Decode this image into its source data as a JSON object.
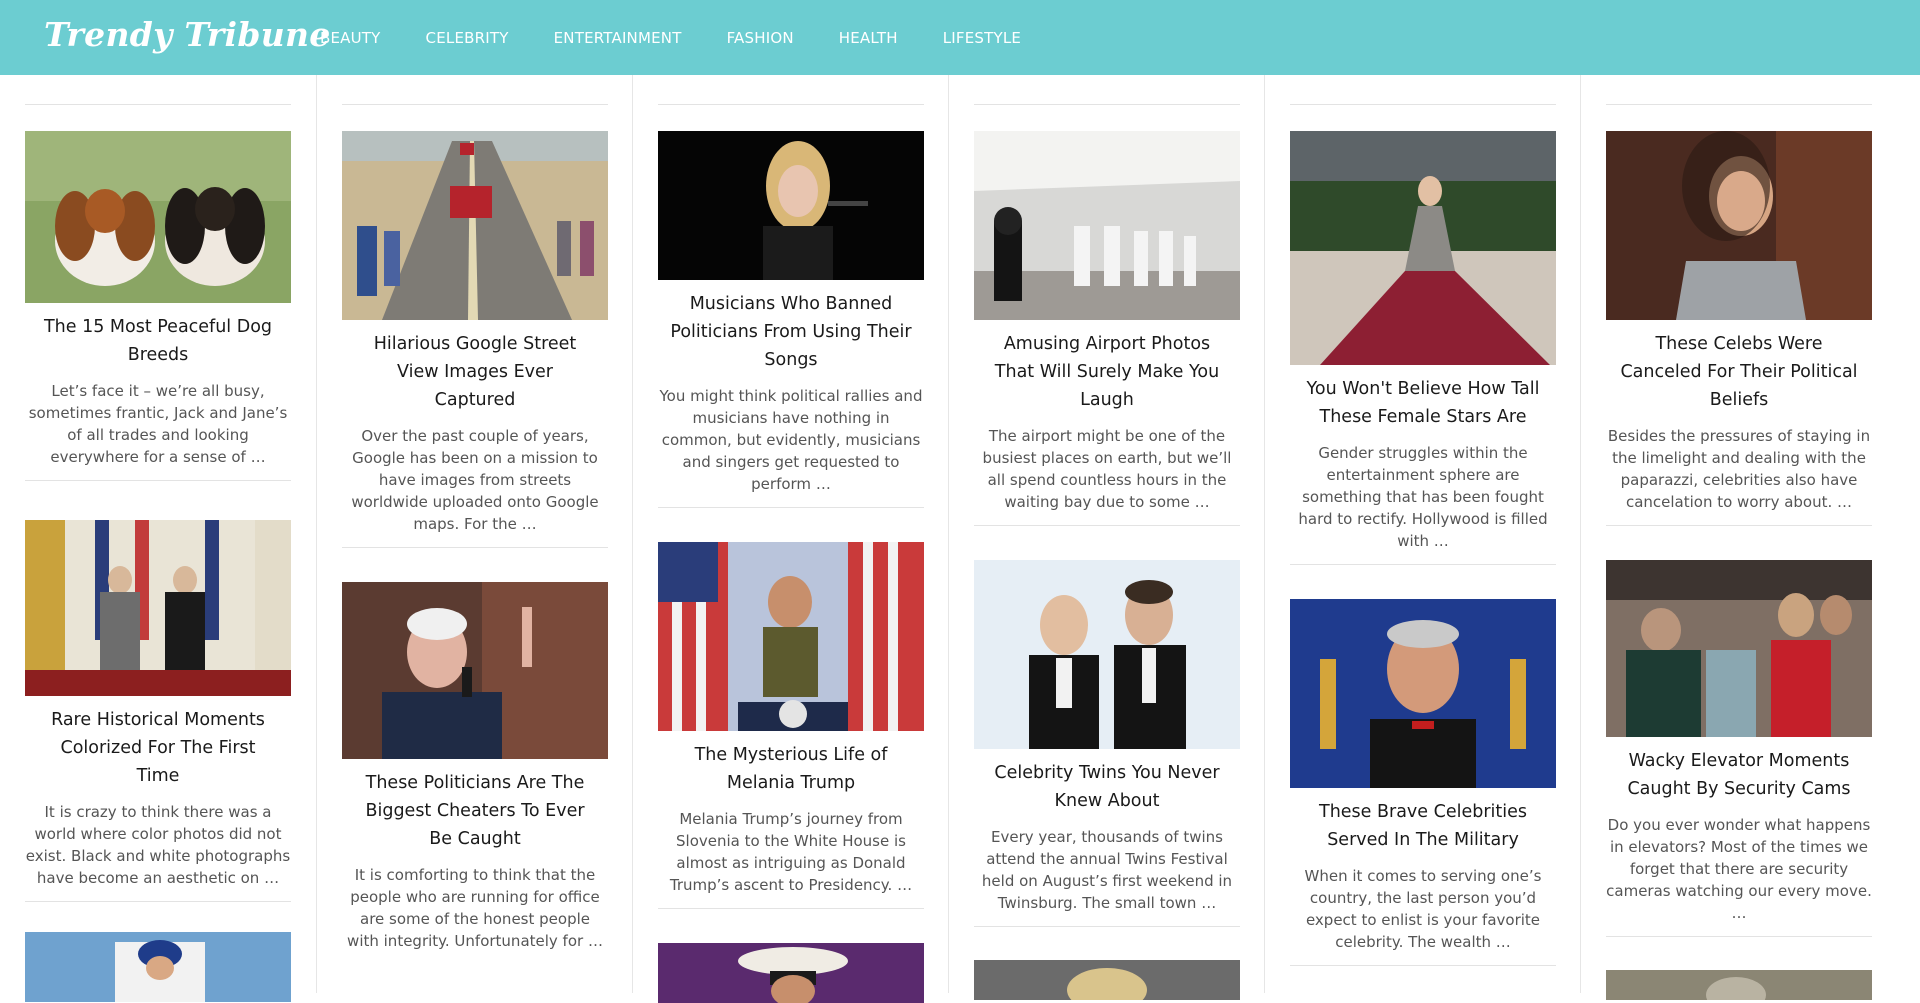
{
  "header": {
    "logo": "Trendy Tribune",
    "nav": [
      "BEAUTY",
      "CELEBRITY",
      "ENTERTAINMENT",
      "FASHION",
      "HEALTH",
      "LIFESTYLE"
    ]
  },
  "columns": [
    {
      "cards": [
        {
          "title": "The 15 Most Peaceful Dog Breeds",
          "excerpt": "Let’s face it – we’re all busy, sometimes frantic, Jack and Jane’s of all trades and looking everywhere for a sense of …",
          "image": "dogs-photo"
        },
        {
          "title": "Rare Historical Moments Colorized For The First Time",
          "excerpt": "It is crazy to think there was a world where color photos did not exist. Black and white photographs have become an aesthetic on …",
          "image": "historical-photo"
        },
        {
          "title": "",
          "excerpt": "",
          "image": "baseball-photo"
        }
      ]
    },
    {
      "cards": [
        {
          "title": "Hilarious Google Street View Images Ever Captured",
          "excerpt": "Over the past couple of years, Google has been on a mission to have images from streets worldwide uploaded onto Google maps. For the …",
          "image": "street-view-photo"
        },
        {
          "title": "These Politicians Are The Biggest Cheaters To Ever Be Caught",
          "excerpt": "It is comforting to think that the people who are running for office are some of the honest people with integrity. Unfortunately for …",
          "image": "politician-photo"
        }
      ]
    },
    {
      "cards": [
        {
          "title": "Musicians Who Banned Politicians From Using Their Songs",
          "excerpt": "You might think political rallies and musicians have nothing in common, but evidently, musicians and singers get requested to perform …",
          "image": "singer-photo"
        },
        {
          "title": "The Mysterious Life of Melania Trump",
          "excerpt": "Melania Trump’s journey from Slovenia to the White House is almost as intriguing as Donald Trump’s ascent to Presidency. …",
          "image": "melania-photo"
        },
        {
          "title": "",
          "excerpt": "",
          "image": "musician-hat-photo"
        }
      ]
    },
    {
      "cards": [
        {
          "title": "Amusing Airport Photos That Will Surely Make You Laugh",
          "excerpt": "The airport might be one of the busiest places on earth, but we’ll all spend countless hours in the waiting bay due to some …",
          "image": "airport-photo"
        },
        {
          "title": "Celebrity Twins You Never Knew About",
          "excerpt": "Every year, thousands of twins attend the annual Twins Festival held on August’s first weekend in Twinsburg. The small town …",
          "image": "twins-photo"
        },
        {
          "title": "",
          "excerpt": "",
          "image": "blonde-photo"
        }
      ]
    },
    {
      "cards": [
        {
          "title": "You Won't Believe How Tall These Female Stars Are",
          "excerpt": "Gender struggles within the entertainment sphere are something that has been fought hard to rectify. Hollywood is filled with …",
          "image": "gown-photo"
        },
        {
          "title": "These Brave Celebrities Served In The Military",
          "excerpt": "When it comes to serving one’s country, the last person you’d expect to enlist is your favorite celebrity. The wealth …",
          "image": "oscars-photo"
        }
      ]
    },
    {
      "cards": [
        {
          "title": "These Celebs Were Canceled For Their Political Beliefs",
          "excerpt": "Besides the pressures of staying in the limelight and dealing with the paparazzi, celebrities also have cancelation to worry about. …",
          "image": "actress-photo"
        },
        {
          "title": "Wacky Elevator Moments Caught By Security Cams",
          "excerpt": "Do you ever wonder what happens in elevators? Most of the times we forget that there are security cameras watching our every move. …",
          "image": "elevator-photo"
        },
        {
          "title": "",
          "excerpt": "",
          "image": "crowd-photo"
        }
      ]
    }
  ]
}
